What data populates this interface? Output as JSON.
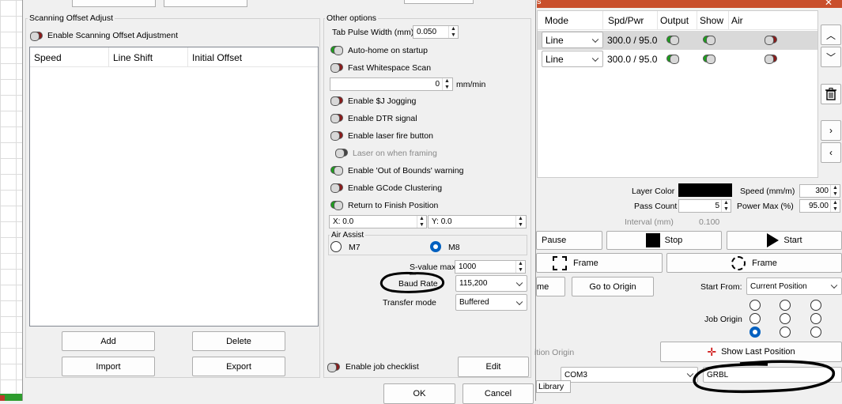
{
  "scanning": {
    "title": "Scanning Offset Adjust",
    "enable_label": "Enable Scanning Offset Adjustment",
    "col_speed": "Speed",
    "col_line_shift": "Line Shift",
    "col_initial_offset": "Initial Offset",
    "add": "Add",
    "delete": "Delete",
    "import": "Import",
    "export": "Export"
  },
  "other": {
    "title": "Other options",
    "tab_pulse_label": "Tab Pulse Width (mm)",
    "tab_pulse_value": "0.050",
    "autohome": "Auto-home on startup",
    "fast_ws": "Fast Whitespace Scan",
    "fast_ws_value": "0",
    "fast_ws_unit": "mm/min",
    "sj_jog": "Enable $J Jogging",
    "dtr": "Enable DTR signal",
    "laser_fire": "Enable laser fire button",
    "laser_framing": "Laser on when framing",
    "oob": "Enable 'Out of Bounds' warning",
    "gcode_cluster": "Enable GCode Clustering",
    "return_finish": "Return to Finish Position",
    "x_label": "X:",
    "x_value": "0.0",
    "y_label": "Y:",
    "y_value": "0.0",
    "air_assist": "Air Assist",
    "m7": "M7",
    "m8": "M8",
    "svalue_label": "S-value max",
    "svalue": "1000",
    "baud_label": "Baud Rate",
    "baud_value": "115,200",
    "transfer_label": "Transfer mode",
    "transfer_value": "Buffered",
    "job_checklist": "Enable job checklist",
    "edit": "Edit"
  },
  "dialog": {
    "ok": "OK",
    "cancel": "Cancel"
  },
  "layers": {
    "title_fragment": "s",
    "headers": [
      "Mode",
      "Spd/Pwr",
      "Output",
      "Show",
      "Air"
    ],
    "rows": [
      {
        "mode": "Line",
        "spdpwr": "300.0 / 95.0"
      },
      {
        "mode": "Line",
        "spdpwr": "300.0 / 95.0"
      }
    ]
  },
  "layer_props": {
    "color_label": "Layer Color",
    "color_value": "#000000",
    "speed_label": "Speed (mm/m)",
    "speed_value": "300",
    "pass_label": "Pass Count",
    "pass_value": "5",
    "power_label": "Power Max (%)",
    "power_value": "95.00",
    "interval_label": "Interval (mm)",
    "interval_value": "0.100"
  },
  "laser": {
    "pause": "Pause",
    "stop": "Stop",
    "start": "Start",
    "frame1": "Frame",
    "frame2": "Frame",
    "home_fragment": "me",
    "go_origin": "Go to Origin",
    "start_from_label": "Start From:",
    "start_from_value": "Current Position",
    "job_origin_label": "Job Origin",
    "origin_fragment": "ition Origin",
    "show_last": "Show Last Position",
    "port": "COM3",
    "device": "GRBL",
    "library_tab": "Library"
  },
  "colors": {
    "accent": "#0060c0",
    "toggle_on": "#1ca01c",
    "toggle_off": "#8b1a1a",
    "title_bar": "#c94f2c"
  }
}
